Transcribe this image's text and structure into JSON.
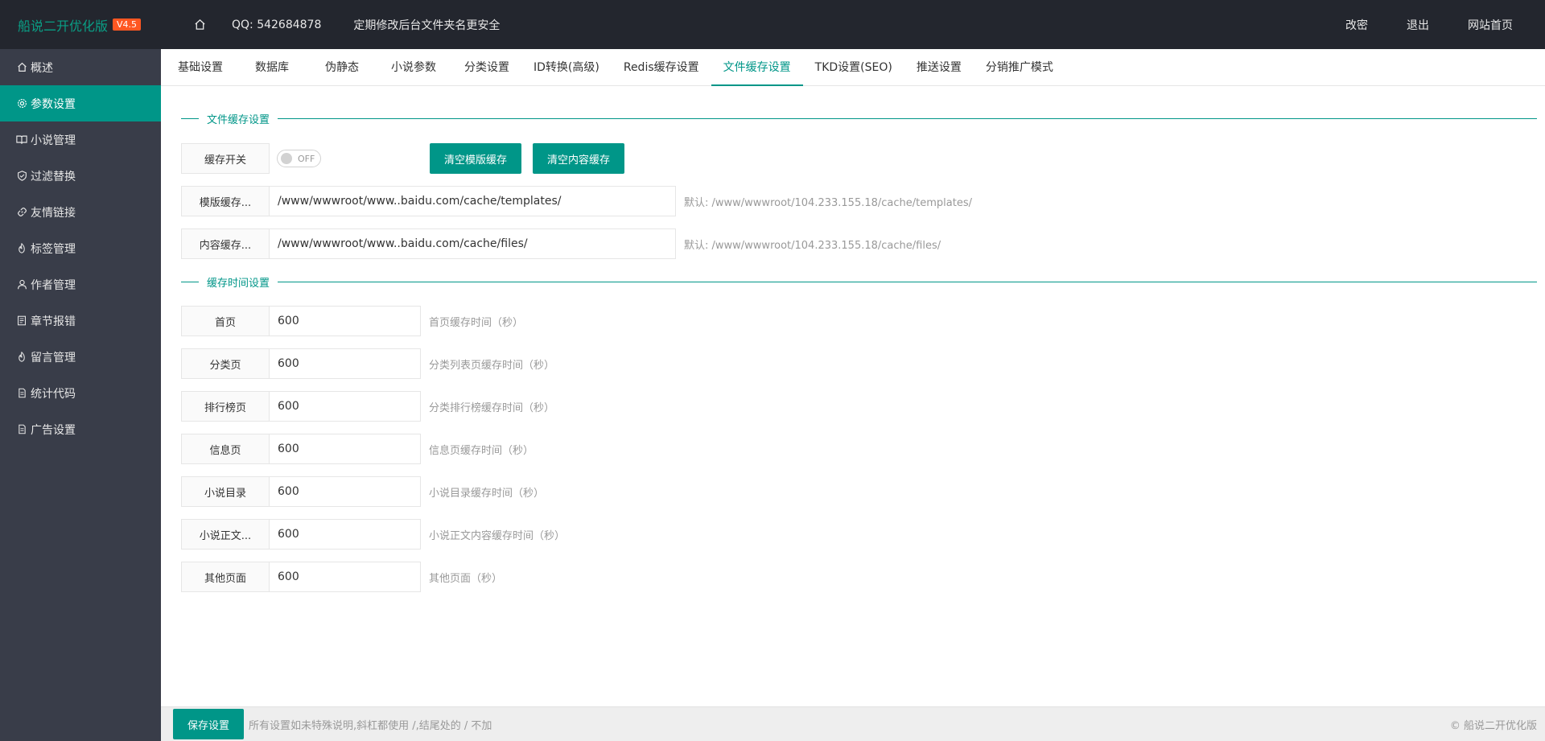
{
  "header": {
    "logo_text": "船说二开优化版",
    "version": "V4.5",
    "qq": "QQ: 542684878",
    "notice": "定期修改后台文件夹名更安全",
    "right_links": [
      "改密",
      "退出",
      "网站首页"
    ]
  },
  "sidebar": {
    "items": [
      {
        "label": "概述",
        "icon": "home-icon"
      },
      {
        "label": "参数设置",
        "icon": "gear-icon",
        "active": true
      },
      {
        "label": "小说管理",
        "icon": "book-icon"
      },
      {
        "label": "过滤替换",
        "icon": "shield-icon"
      },
      {
        "label": "友情链接",
        "icon": "link-icon"
      },
      {
        "label": "标签管理",
        "icon": "fire-icon"
      },
      {
        "label": "作者管理",
        "icon": "user-icon"
      },
      {
        "label": "章节报错",
        "icon": "report-icon"
      },
      {
        "label": "留言管理",
        "icon": "fire-icon"
      },
      {
        "label": "统计代码",
        "icon": "file-icon"
      },
      {
        "label": "广告设置",
        "icon": "file-icon"
      }
    ]
  },
  "tabs": [
    "基础设置",
    "数据库",
    "伪静态",
    "小说参数",
    "分类设置",
    "ID转换(高级)",
    "Redis缓存设置",
    "文件缓存设置",
    "TKD设置(SEO)",
    "推送设置",
    "分销推广模式"
  ],
  "active_tab": "文件缓存设置",
  "section1": {
    "title": "文件缓存设置",
    "cache_switch_label": "缓存开关",
    "toggle_text": "OFF",
    "clear_template_btn": "清空模版缓存",
    "clear_content_btn": "清空内容缓存",
    "template_path_label": "模版缓存...",
    "template_path_value": "/www/wwwroot/www..baidu.com/cache/templates/",
    "template_path_hint": "默认: /www/wwwroot/104.233.155.18/cache/templates/",
    "content_path_label": "内容缓存...",
    "content_path_value": "/www/wwwroot/www..baidu.com/cache/files/",
    "content_path_hint": "默认: /www/wwwroot/104.233.155.18/cache/files/"
  },
  "section2": {
    "title": "缓存时间设置",
    "rows": [
      {
        "label": "首页",
        "value": "600",
        "hint": "首页缓存时间（秒）"
      },
      {
        "label": "分类页",
        "value": "600",
        "hint": "分类列表页缓存时间（秒）"
      },
      {
        "label": "排行榜页",
        "value": "600",
        "hint": "分类排行榜缓存时间（秒）"
      },
      {
        "label": "信息页",
        "value": "600",
        "hint": "信息页缓存时间（秒）"
      },
      {
        "label": "小说目录",
        "value": "600",
        "hint": "小说目录缓存时间（秒）"
      },
      {
        "label": "小说正文...",
        "value": "600",
        "hint": "小说正文内容缓存时间（秒）"
      },
      {
        "label": "其他页面",
        "value": "600",
        "hint": "其他页面（秒）"
      }
    ]
  },
  "footer": {
    "save_label": "保存设置",
    "note": "所有设置如未特殊说明,斜杠都使用 /,结尾处的 / 不加",
    "copyright": "© 船说二开优化版"
  },
  "colors": {
    "accent": "#009688",
    "header_bg": "#23262e",
    "sidebar_bg": "#393d49",
    "version_badge": "#ff5722"
  }
}
